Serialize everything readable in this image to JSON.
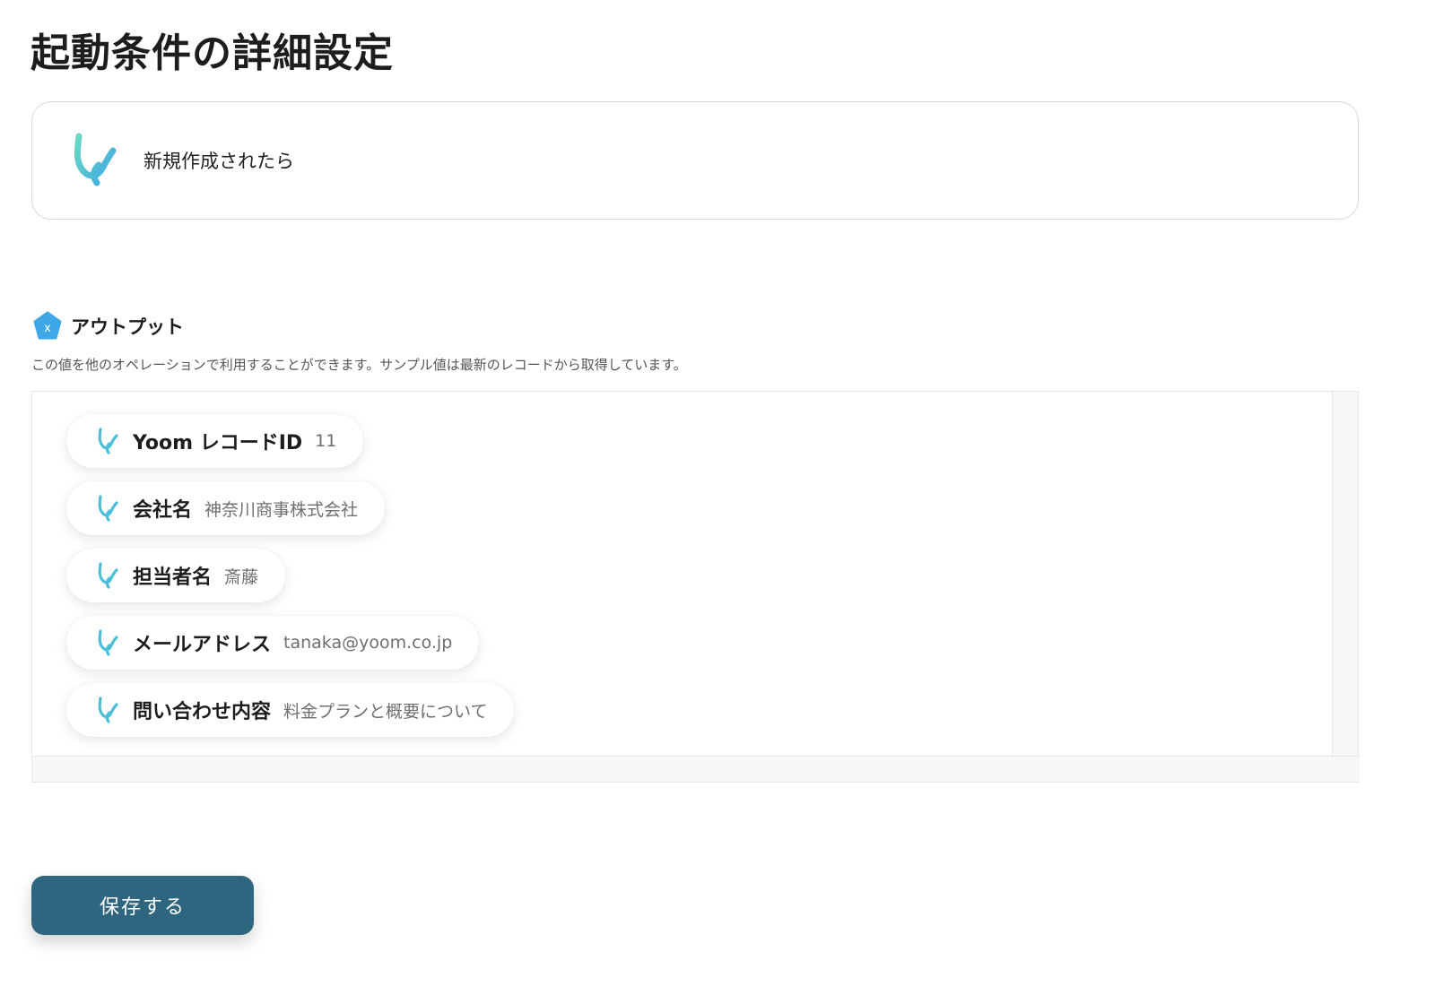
{
  "page": {
    "title": "起動条件の詳細設定"
  },
  "trigger": {
    "label": "新規作成されたら",
    "icon": "yoom-logo-icon"
  },
  "output": {
    "title": "アウトプット",
    "icon": "variable-badge-icon",
    "description": "この値を他のオペレーションで利用することができます。サンプル値は最新のレコードから取得しています。",
    "items": [
      {
        "label": "Yoom レコードID",
        "value": "11"
      },
      {
        "label": "会社名",
        "value": "神奈川商事株式会社"
      },
      {
        "label": "担当者名",
        "value": "斎藤"
      },
      {
        "label": "メールアドレス",
        "value": "tanaka@yoom.co.jp"
      },
      {
        "label": "問い合わせ内容",
        "value": "料金プランと概要について"
      }
    ]
  },
  "footer": {
    "save_label": "保存する"
  },
  "colors": {
    "accent": "#2e6680",
    "logo_gradient_start": "#5fd3c6",
    "logo_gradient_end": "#3ea8e6"
  }
}
